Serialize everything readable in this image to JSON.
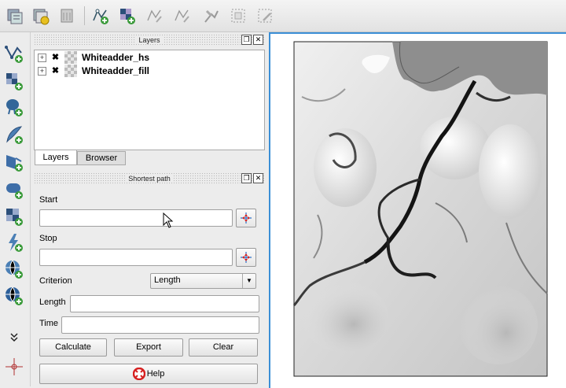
{
  "toolbar": {
    "icons": [
      "add-vector-raster-icon",
      "add-raster-icon",
      "add-layer-grey-icon",
      "new-vector-layer-icon",
      "add-raster-green-icon",
      "digitize-line-icon",
      "digitize-polygon-icon",
      "node-tool-icon",
      "select-area-icon",
      "edit-area-icon"
    ]
  },
  "left_toolbar": {
    "icons": [
      "add-vector-layer-icon",
      "add-raster-layer-icon",
      "add-postgis-layer-icon",
      "add-spatialite-layer-icon",
      "add-mssql-layer-icon",
      "add-oracle-layer-icon",
      "add-wms-layer-icon",
      "add-wcs-layer-icon",
      "add-wfs-layer-icon",
      "add-web-layer-icon",
      "more-tools-icon",
      "crosshair-icon"
    ]
  },
  "layers_panel": {
    "title": "Layers",
    "items": [
      {
        "name": "Whiteadder_hs",
        "checked": true
      },
      {
        "name": "Whiteadder_fill",
        "checked": true
      }
    ],
    "tabs": [
      "Layers",
      "Browser"
    ]
  },
  "shortest_path": {
    "title": "Shortest path",
    "start_label": "Start",
    "start_value": "",
    "stop_label": "Stop",
    "stop_value": "",
    "criterion_label": "Criterion",
    "criterion_value": "Length",
    "length_label": "Length",
    "length_value": "",
    "time_label": "Time",
    "time_value": "",
    "calculate_label": "Calculate",
    "export_label": "Export",
    "clear_label": "Clear",
    "help_label": "Help"
  },
  "colors": {
    "accent": "#3b8fd6",
    "picker_red": "#d62020",
    "picker_blue": "#2a6fc9"
  }
}
